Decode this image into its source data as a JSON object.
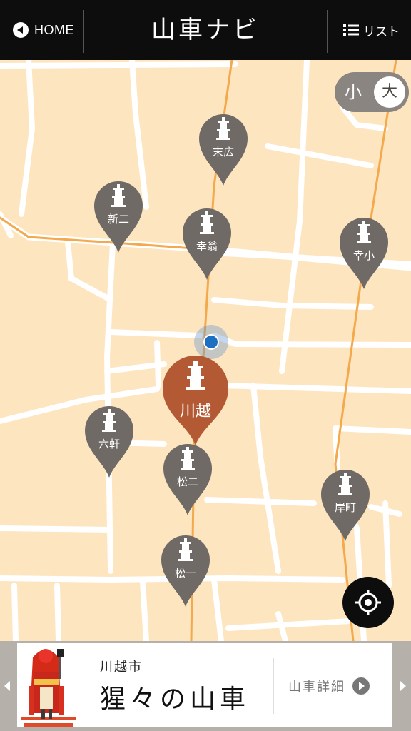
{
  "header": {
    "home_label": "HOME",
    "title": "山車ナビ",
    "list_label": "リスト"
  },
  "size_toggle": {
    "small": "小",
    "large": "大"
  },
  "pins": [
    {
      "label": "末広",
      "active": false
    },
    {
      "label": "新二",
      "active": false
    },
    {
      "label": "幸翁",
      "active": false
    },
    {
      "label": "幸小",
      "active": false
    },
    {
      "label": "川越",
      "active": true
    },
    {
      "label": "六軒",
      "active": false
    },
    {
      "label": "松二",
      "active": false
    },
    {
      "label": "岸町",
      "active": false
    },
    {
      "label": "松一",
      "active": false
    }
  ],
  "card": {
    "city": "川越市",
    "name": "猩々の山車",
    "detail_label": "山車詳細"
  },
  "colors": {
    "map_background": "#fde5c0",
    "road": "#ffffff",
    "main_road": "#f3a94c",
    "pin": "#6f6a66",
    "pin_active": "#b35a35",
    "header": "#0d0d0d"
  }
}
